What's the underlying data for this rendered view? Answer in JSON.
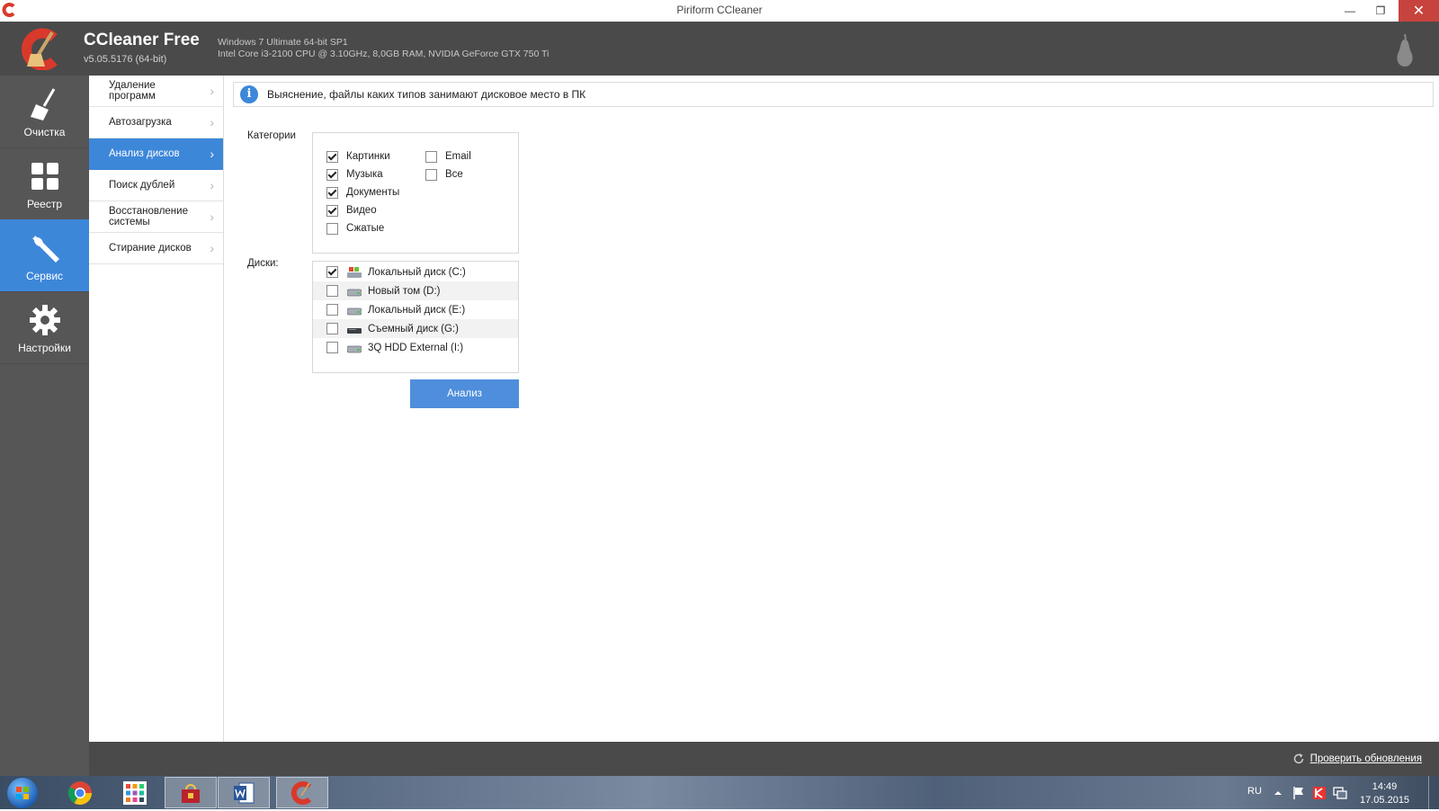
{
  "window": {
    "title": "Piriform CCleaner",
    "minimize": "—",
    "maximize": "❐",
    "close": "✕"
  },
  "header": {
    "app_name": "CCleaner Free",
    "version": "v5.05.5176 (64-bit)",
    "os_line": "Windows 7 Ultimate 64-bit SP1",
    "hw_line": "Intel Core i3-2100 CPU @ 3.10GHz, 8,0GB RAM, NVIDIA GeForce GTX 750 Ti"
  },
  "leftnav": {
    "items": [
      {
        "label": "Очистка",
        "icon": "broom-icon"
      },
      {
        "label": "Реестр",
        "icon": "grid-icon"
      },
      {
        "label": "Сервис",
        "icon": "wrench-icon",
        "active": true
      },
      {
        "label": "Настройки",
        "icon": "gear-icon"
      }
    ]
  },
  "subnav": {
    "items": [
      {
        "label": "Удаление программ"
      },
      {
        "label": "Автозагрузка"
      },
      {
        "label": "Анализ дисков",
        "active": true
      },
      {
        "label": "Поиск дублей"
      },
      {
        "label": "Восстановление системы"
      },
      {
        "label": "Стирание дисков"
      }
    ]
  },
  "main": {
    "info_text": "Выяснение, файлы каких типов занимают дисковое место в ПК",
    "info_icon": "i",
    "categories_label": "Категории",
    "categories": [
      {
        "label": "Картинки",
        "checked": true
      },
      {
        "label": "Музыка",
        "checked": true
      },
      {
        "label": "Документы",
        "checked": true
      },
      {
        "label": "Видео",
        "checked": true
      },
      {
        "label": "Сжатые",
        "checked": false
      },
      {
        "label": "Email",
        "checked": false
      },
      {
        "label": "Все",
        "checked": false
      }
    ],
    "disks_label": "Диски:",
    "disks": [
      {
        "label": "Локальный диск (C:)",
        "checked": true,
        "icon": "system-drive-icon"
      },
      {
        "label": "Новый том (D:)",
        "checked": false,
        "icon": "hard-drive-icon"
      },
      {
        "label": "Локальный диск (E:)",
        "checked": false,
        "icon": "hard-drive-icon"
      },
      {
        "label": "Съемный диск (G:)",
        "checked": false,
        "icon": "removable-drive-icon"
      },
      {
        "label": "3Q HDD External (I:)",
        "checked": false,
        "icon": "hard-drive-icon"
      }
    ],
    "analyze_button": "Анализ"
  },
  "footer": {
    "update_link": "Проверить обновления"
  },
  "taskbar": {
    "lang": "RU",
    "time": "14:49",
    "date": "17.05.2015"
  },
  "colors": {
    "accent": "#3d87d9",
    "header_bg": "#4a4a4a",
    "nav_bg": "#565656",
    "close_red": "#c7433d"
  }
}
